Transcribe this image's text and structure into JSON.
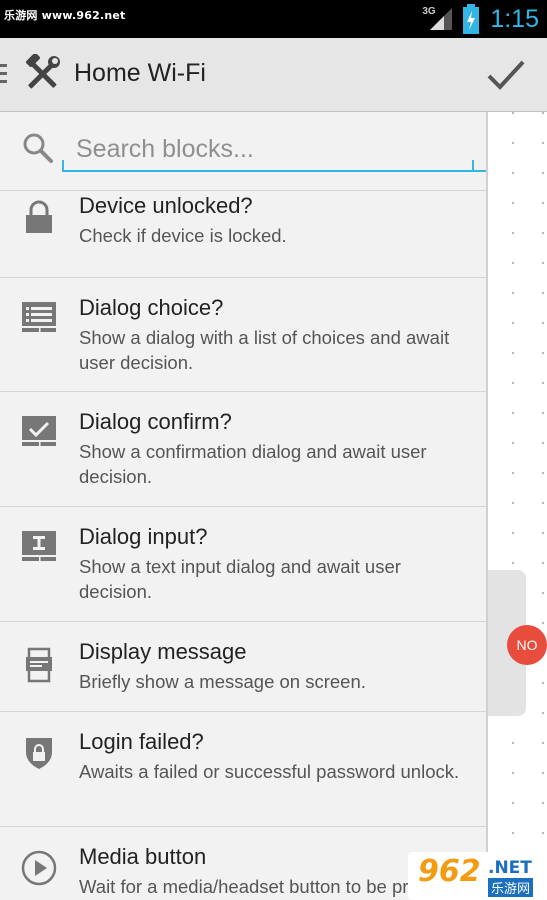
{
  "status_bar": {
    "watermark": "乐游网 www.962.net",
    "network_type": "3G",
    "time": "1:15"
  },
  "action_bar": {
    "title": "Home Wi-Fi",
    "done_icon": "checkmark-icon",
    "app_icon": "tools-icon"
  },
  "search": {
    "placeholder": "Search blocks..."
  },
  "blocks": [
    {
      "title": "Device unlocked?",
      "description": "Check if device is locked.",
      "icon": "lock-icon"
    },
    {
      "title": "Dialog choice?",
      "description": "Show a dialog with a list of choices and await user decision.",
      "icon": "list-dialog-icon"
    },
    {
      "title": "Dialog confirm?",
      "description": "Show a confirmation dialog and await user decision.",
      "icon": "confirm-dialog-icon"
    },
    {
      "title": "Dialog input?",
      "description": "Show a text input dialog and await user decision.",
      "icon": "input-dialog-icon"
    },
    {
      "title": "Display message",
      "description": "Briefly show a message on screen.",
      "icon": "message-icon"
    },
    {
      "title": "Login failed?",
      "description": "Awaits a failed or successful password unlock.",
      "icon": "shield-lock-icon"
    },
    {
      "title": "Media button",
      "description": "Wait for a media/headset button to be pressed.",
      "icon": "play-icon"
    }
  ],
  "canvas": {
    "badge": "NO"
  },
  "watermark_bottom": {
    "number": "962",
    "net": ".NET",
    "cn": "乐游网"
  },
  "colors": {
    "accent": "#33b5e5",
    "badge": "#e74c3c",
    "drawer_bg": "#f2f2f2",
    "action_bar_bg": "#e6e6e6"
  }
}
